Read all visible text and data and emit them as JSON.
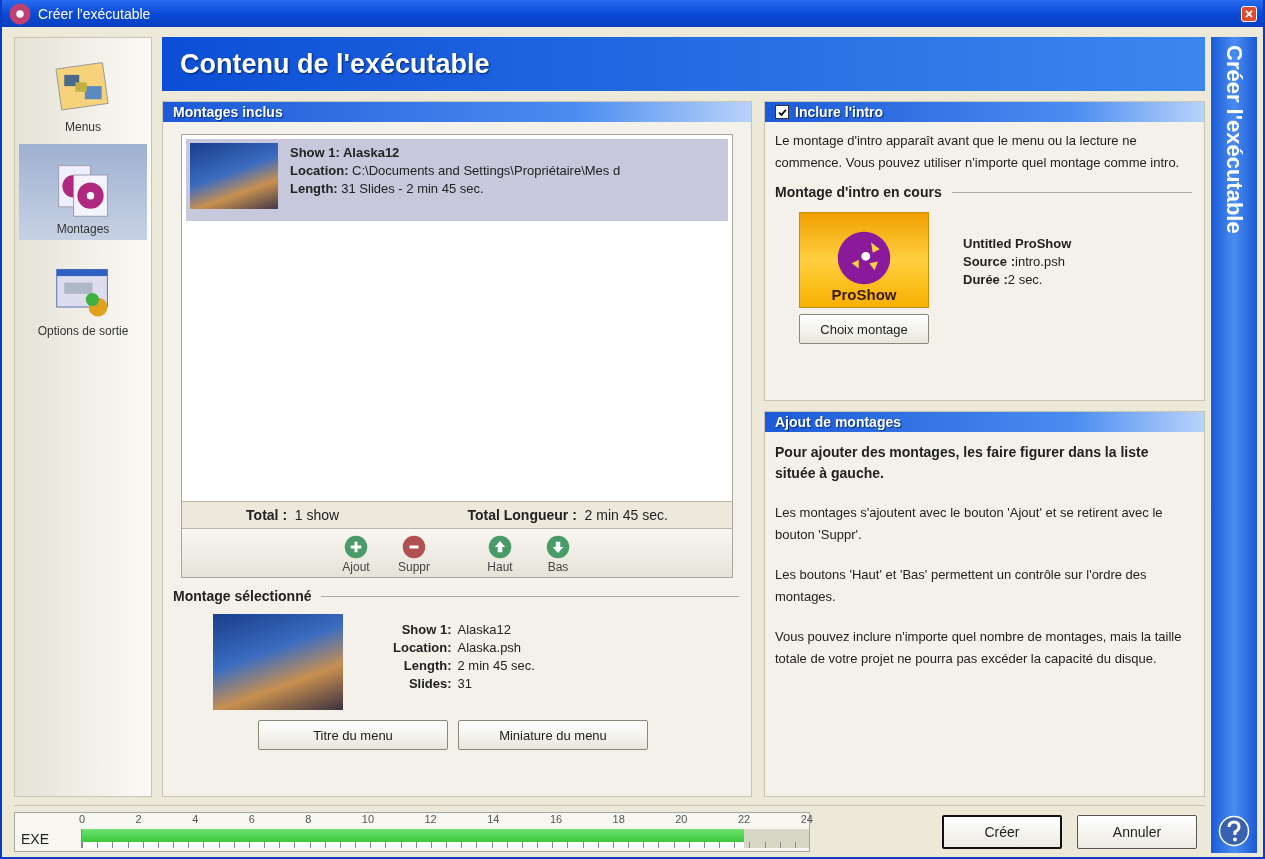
{
  "window": {
    "title": "Créer l'exécutable"
  },
  "sidebar": {
    "items": [
      {
        "label": "Menus",
        "kind": "menus",
        "selected": false
      },
      {
        "label": "Montages",
        "kind": "montages",
        "selected": true
      },
      {
        "label": "Options de sortie",
        "kind": "output",
        "selected": false
      }
    ]
  },
  "header": {
    "title": "Contenu de l'exécutable"
  },
  "included": {
    "title": "Montages inclus",
    "shows": [
      {
        "name_label": "Show 1:",
        "name": "Alaska12",
        "location_label": "Location:",
        "location": "C:\\Documents and Settings\\Propriétaire\\Mes d",
        "length_label": "Length:",
        "length": "31 Slides - 2 min 45 sec.",
        "selected": true
      }
    ],
    "total_label": "Total :",
    "total": "1 show",
    "length_label": "Total Longueur :",
    "length": "2 min 45 sec.",
    "actions": [
      {
        "label": "Ajout",
        "kind": "add"
      },
      {
        "label": "Suppr",
        "kind": "remove"
      },
      {
        "label": "Haut",
        "kind": "up"
      },
      {
        "label": "Bas",
        "kind": "down"
      }
    ]
  },
  "selected_show": {
    "title": "Montage sélectionné",
    "fields": [
      {
        "label": "Show 1:",
        "value": "Alaska12"
      },
      {
        "label": "Location:",
        "value": "Alaska.psh"
      },
      {
        "label": "Length:",
        "value": "2 min 45 sec."
      },
      {
        "label": "Slides:",
        "value": "31"
      }
    ],
    "buttons": [
      "Titre du menu",
      "Miniature du menu"
    ]
  },
  "intro": {
    "title": "Inclure l'intro",
    "checked": true,
    "description": "Le montage d'intro apparaît avant que le menu ou la lecture ne commence. Vous pouvez utiliser n'importe quel montage comme intro.",
    "current_title": "Montage d'intro en cours",
    "logo_text": "ProShow",
    "show_name": "Untitled ProShow",
    "fields": [
      {
        "label": "Source :",
        "value": "intro.psh"
      },
      {
        "label": "Durée :",
        "value": "2 sec."
      }
    ],
    "button": "Choix montage"
  },
  "adding": {
    "title": "Ajout de montages",
    "lead": "Pour ajouter des montages, les faire figurer dans la liste située à gauche.",
    "paragraphs": [
      "Les montages s'ajoutent avec le bouton 'Ajout' et se retirent avec le bouton 'Suppr'.",
      "Les boutons 'Haut' et 'Bas' permettent un contrôle sur l'ordre des montages.",
      "Vous pouvez inclure n'importe quel nombre de montages, mais la taille totale de votre projet ne pourra pas excéder la capacité du disque."
    ]
  },
  "side_banner": "Créer l'exécutable",
  "capacity": {
    "label": "EXE",
    "ticks": [
      "0",
      "2",
      "4",
      "6",
      "8",
      "10",
      "12",
      "14",
      "16",
      "18",
      "20",
      "22",
      "24"
    ],
    "level": 0.91
  },
  "buttons": [
    {
      "label": "Créer",
      "default": true
    },
    {
      "label": "Annuler",
      "default": false
    }
  ]
}
